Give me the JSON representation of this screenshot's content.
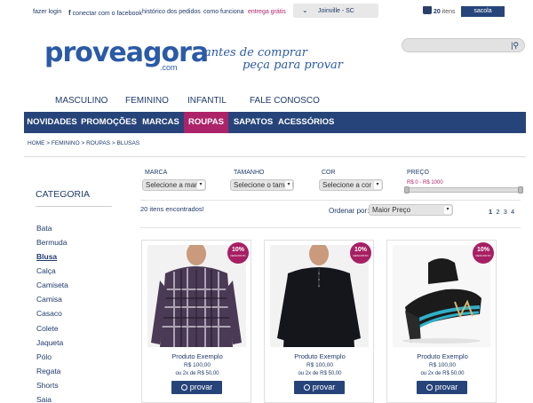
{
  "topbar": {
    "links": [
      "fazer login",
      "conectar com o facebook",
      "histórico dos pedidos",
      "como funciona"
    ],
    "facebook_glyph": "f",
    "free_shipping": "entrega grátis",
    "city": "Joinville - SC",
    "cart_count": "20",
    "cart_unit": "itens",
    "cart_button": "sacola"
  },
  "brand": {
    "logo": "proveagora",
    "logo_suffix": ".com",
    "slogan_line1": "antes de comprar",
    "slogan_line2": "peça para provar"
  },
  "search": {
    "placeholder": ""
  },
  "category_nav": [
    "MASCULINO",
    "FEMININO",
    "INFANTIL",
    "FALE CONOSCO"
  ],
  "main_nav": {
    "items": [
      "NOVIDADES",
      "PROMOÇÕES",
      "MARCAS",
      "ROUPAS",
      "SAPATOS",
      "ACESSÓRIOS"
    ],
    "active": "ROUPAS"
  },
  "breadcrumb": "HOME >  FEMININO >  ROUPAS >  BLUSAS",
  "sidebar": {
    "title": "CATEGORIA",
    "items": [
      "Bata",
      "Bermuda",
      "Blusa",
      "Calça",
      "Camiseta",
      "Camisa",
      "Casaco",
      "Colete",
      "Jaqueta",
      "Pólo",
      "Regata",
      "Shorts",
      "Saia"
    ],
    "selected": "Blusa"
  },
  "filters": {
    "marca": {
      "label": "MARCA",
      "value": "Selecione a marca"
    },
    "tamanho": {
      "label": "TAMANHO",
      "value": "Selecione o tamanho"
    },
    "cor": {
      "label": "COR",
      "value": "Selecione a cor"
    },
    "preco": {
      "label": "PREÇO",
      "value": "R$ 0 - R$ 1000"
    }
  },
  "results": {
    "count_text": "20 itens encontrados!",
    "order_label": "Ordenar por:",
    "order_value": "Maior Preço",
    "pages": [
      "1",
      "2",
      "3",
      "4"
    ],
    "current_page": "1"
  },
  "products": [
    {
      "name": "Produto Exemplo",
      "price": "R$ 100,00",
      "installments": "ou 2x de R$ 50,00",
      "badge_pct": "10%",
      "badge_text": "DESCONTO",
      "button": "provar"
    },
    {
      "name": "Produto Exemplo",
      "price": "R$ 100,00",
      "installments": "ou 2x de R$ 50,00",
      "badge_pct": "10%",
      "badge_text": "DESCONTO",
      "button": "provar"
    },
    {
      "name": "Produto Exemplo",
      "price": "R$ 100,00",
      "installments": "ou 2x de R$ 50,00",
      "badge_pct": "10%",
      "badge_text": "DESCONTO",
      "button": "provar"
    }
  ],
  "colors": {
    "navy": "#27447a",
    "accent": "#ad2369",
    "brand_blue": "#2b5aa6"
  }
}
